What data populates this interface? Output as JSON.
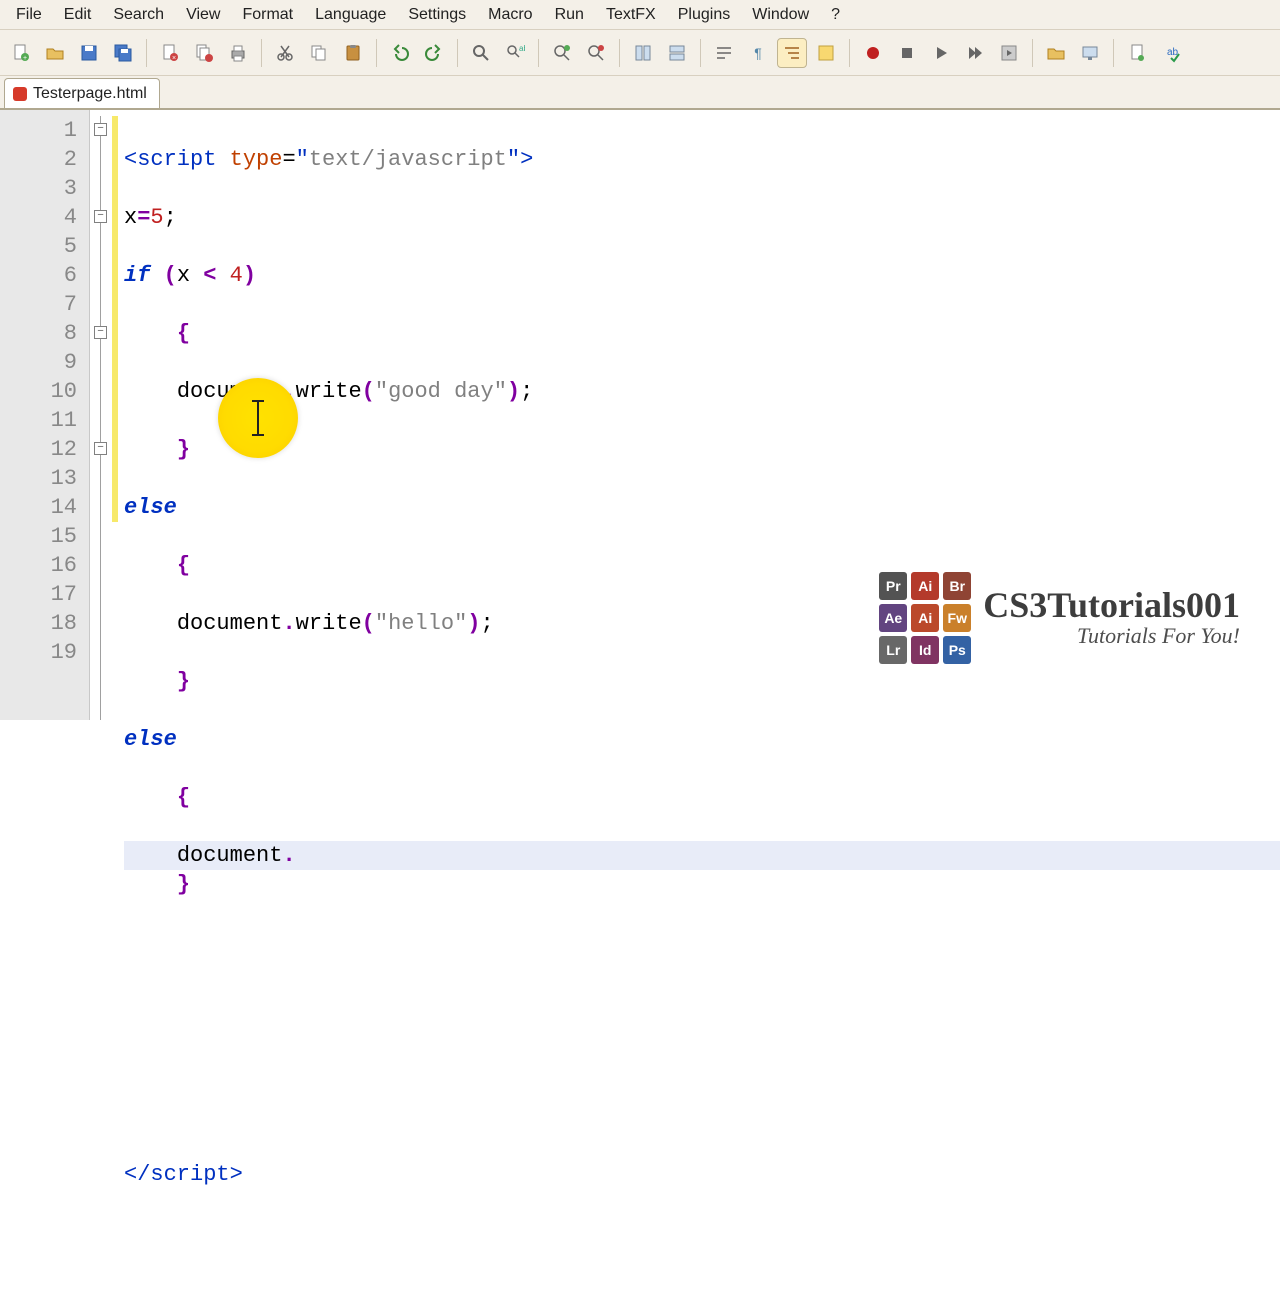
{
  "menu": [
    "File",
    "Edit",
    "Search",
    "View",
    "Format",
    "Language",
    "Settings",
    "Macro",
    "Run",
    "TextFX",
    "Plugins",
    "Window",
    "?"
  ],
  "tab": {
    "filename": "Testerpage.html"
  },
  "gutter": [
    "1",
    "2",
    "3",
    "4",
    "5",
    "6",
    "7",
    "8",
    "9",
    "10",
    "11",
    "12",
    "13",
    "14",
    "15",
    "16",
    "17",
    "18",
    "19"
  ],
  "code": {
    "l1": {
      "open": "<",
      "tag": "script",
      "sp": " ",
      "attr": "type",
      "eq": "=",
      "q1": "\"",
      "val": "text/javascript",
      "q2": "\"",
      "close": ">"
    },
    "l2": {
      "a": "x",
      "eq": "=",
      "n": "5",
      "sc": ";"
    },
    "l3": {
      "kw": "if",
      "sp": " ",
      "p1": "(",
      "a": "x ",
      "op": "<",
      "b": " ",
      "n": "4",
      "p2": ")"
    },
    "l4": {
      "b": "{"
    },
    "l5": {
      "a": "document",
      "d": ".",
      "b": "write",
      "p1": "(",
      "q1": "\"",
      "s": "good day",
      "q2": "\"",
      "p2": ")",
      "sc": ";"
    },
    "l6": {
      "b": "}"
    },
    "l7": {
      "kw": "else"
    },
    "l8": {
      "b": "{"
    },
    "l9": {
      "a": "document",
      "d": ".",
      "b": "write",
      "p1": "(",
      "q1": "\"",
      "s": "hello",
      "q2": "\"",
      "p2": ")",
      "sc": ";"
    },
    "l10": {
      "b": "}"
    },
    "l11": {
      "kw": "else"
    },
    "l12": {
      "b": "{"
    },
    "l13": {
      "a": "document",
      "d": "."
    },
    "l14": {
      "b": "}"
    },
    "l19": {
      "open": "</",
      "tag": "script",
      "close": ">"
    }
  },
  "watermark": {
    "title": "CS3Tutorials001",
    "subtitle": "Tutorials For You!",
    "cells": [
      {
        "bg": "#4a4a4a",
        "t": "Pr"
      },
      {
        "bg": "#b03020",
        "t": "Ai"
      },
      {
        "bg": "#8a3a2a",
        "t": "Br"
      },
      {
        "bg": "#5a3a7a",
        "t": "Ae"
      },
      {
        "bg": "#b84020",
        "t": "Ai"
      },
      {
        "bg": "#c87a20",
        "t": "Fw"
      },
      {
        "bg": "#606060",
        "t": "Lr"
      },
      {
        "bg": "#7a2a5a",
        "t": "Id"
      },
      {
        "bg": "#2a5aa0",
        "t": "Ps"
      }
    ]
  }
}
